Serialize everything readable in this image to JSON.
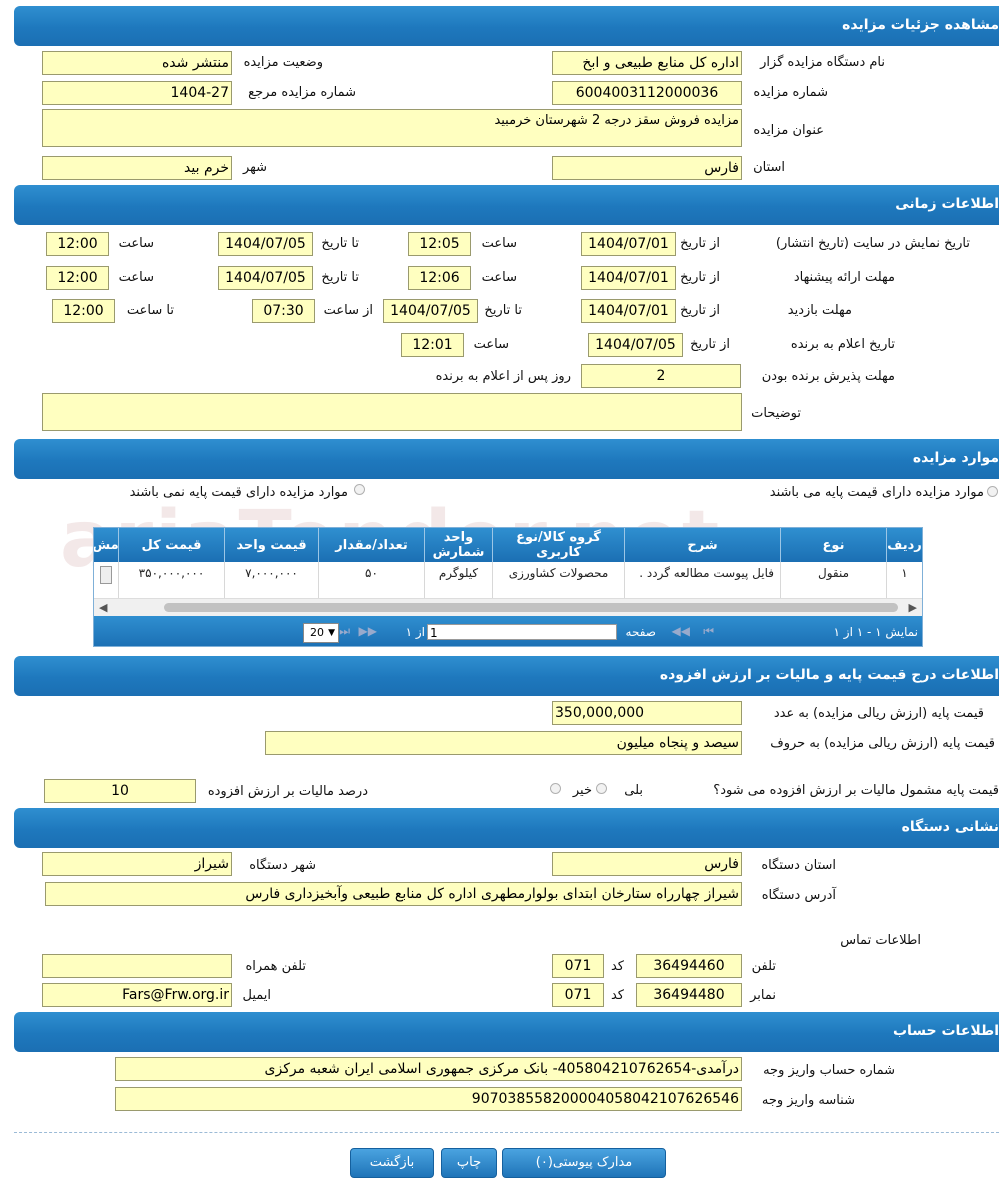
{
  "sections": {
    "details": "مشاهده جزئیات مزایده",
    "time": "اطلاعات زمانی",
    "items": "موارد مزایده",
    "price": "اطلاعات درج قیمت پایه و مالیات بر ارزش افزوده",
    "address": "نشانی دستگاه",
    "account": "اطلاعات حساب"
  },
  "details": {
    "org_label": "نام دستگاه مزایده گزار",
    "org_value": "اداره کل منابع طبیعی و ابخ",
    "status_label": "وضعیت مزایده",
    "status_value": "منتشر شده",
    "number_label": "شماره مزایده",
    "number_value": "6004003112000036",
    "ref_label": "شماره مزایده مرجع",
    "ref_value": "1404-27",
    "title_label": "عنوان مزایده",
    "title_value": "مزایده فروش سقز درجه 2 شهرستان خرمبید",
    "province_label": "استان",
    "province_value": "فارس",
    "city_label": "شهر",
    "city_value": "خرم بید"
  },
  "time": {
    "from_date": "از تاریخ",
    "to_date": "تا تاریخ",
    "hour": "ساعت",
    "from_hour": "از ساعت",
    "to_hour": "تا ساعت",
    "row1_label": "تاریخ نمایش در سایت (تاریخ انتشار)",
    "row1_from": "1404/07/01",
    "row1_from_time": "12:05",
    "row1_to": "1404/07/05",
    "row1_to_time": "12:00",
    "row2_label": "مهلت ارائه پیشنهاد",
    "row2_from": "1404/07/01",
    "row2_from_time": "12:06",
    "row2_to": "1404/07/05",
    "row2_to_time": "12:00",
    "row3_label": "مهلت بازدید",
    "row3_from": "1404/07/01",
    "row3_to": "1404/07/05",
    "row3_from_time": "07:30",
    "row3_to_time": "12:00",
    "row4_label": "تاریخ اعلام به برنده",
    "row4_from": "1404/07/05",
    "row4_time": "12:01",
    "row5_label": "مهلت پذیرش برنده بودن",
    "row5_value": "2",
    "row5_suffix": "روز پس از اعلام به برنده",
    "desc_label": "توضیحات",
    "desc_value": ""
  },
  "items": {
    "radio_with_price": "موارد مزایده دارای قیمت پایه می باشند",
    "radio_without_price": "موارد مزایده دارای قیمت پایه نمی باشند",
    "columns": {
      "row": "ردیف",
      "type": "نوع",
      "desc": "شرح",
      "group": "گروه کالا/نوع کاربری",
      "unit": "واحد شمارش",
      "qty": "تعداد/مقدار",
      "unit_price": "قیمت واحد",
      "total": "قیمت کل",
      "more": "مش"
    },
    "rows": [
      {
        "row": "۱",
        "type": "منقول",
        "desc": "فایل پیوست مطالعه گردد .",
        "group": "محصولات کشاورزی",
        "unit": "کیلوگرم",
        "qty": "۵۰",
        "unit_price": "۷,۰۰۰,۰۰۰",
        "total": "۳۵۰,۰۰۰,۰۰۰"
      }
    ],
    "pager": {
      "display": "نمایش ۱ - ۱ از ۱",
      "page_label": "صفحه",
      "page_value": "1",
      "of_label": "از ۱",
      "page_size": "20"
    }
  },
  "price": {
    "base_num_label": "قیمت پایه (ارزش ریالی مزایده) به عدد",
    "base_num_value": "350,000,000",
    "base_text_label": "قیمت پایه (ارزش ریالی مزایده) به حروف",
    "base_text_value": "سیصد و پنجاه میلیون",
    "vat_question": "قیمت پایه مشمول مالیات بر ارزش افزوده می شود؟",
    "yes": "بلی",
    "no": "خیر",
    "vat_percent_label": "درصد مالیات بر ارزش افزوده",
    "vat_percent_value": "10"
  },
  "address": {
    "province_label": "استان دستگاه",
    "province_value": "فارس",
    "city_label": "شهر دستگاه",
    "city_value": "شیراز",
    "addr_label": "آدرس دستگاه",
    "addr_value": "شیراز چهارراه ستارخان ابتدای بولوارمطهری اداره کل منابع طبیعی وآبخیزداری فارس",
    "contact_label": "اطلاعات تماس",
    "phone_label": "تلفن",
    "phone_value": "36494460",
    "code_label": "کد",
    "phone_code": "071",
    "fax_label": "نمابر",
    "fax_value": "36494480",
    "fax_code": "071",
    "mobile_label": "تلفن همراه",
    "mobile_value": "",
    "email_label": "ایمیل",
    "email_value": "Fars@Frw.org.ir"
  },
  "account": {
    "acc_label": "شماره حساب واریز وجه",
    "acc_value": "درآمدی-405804210762654- بانک مرکزی جمهوری اسلامی ایران شعبه مرکزی",
    "id_label": "شناسه واریز وجه",
    "id_value": "907038558200004058042107626546"
  },
  "buttons": {
    "attachments": "مدارک پیوستی(۰)",
    "print": "چاپ",
    "back": "بازگشت"
  },
  "colors": {
    "header": "#1e78bd",
    "field": "#ffffc0"
  }
}
